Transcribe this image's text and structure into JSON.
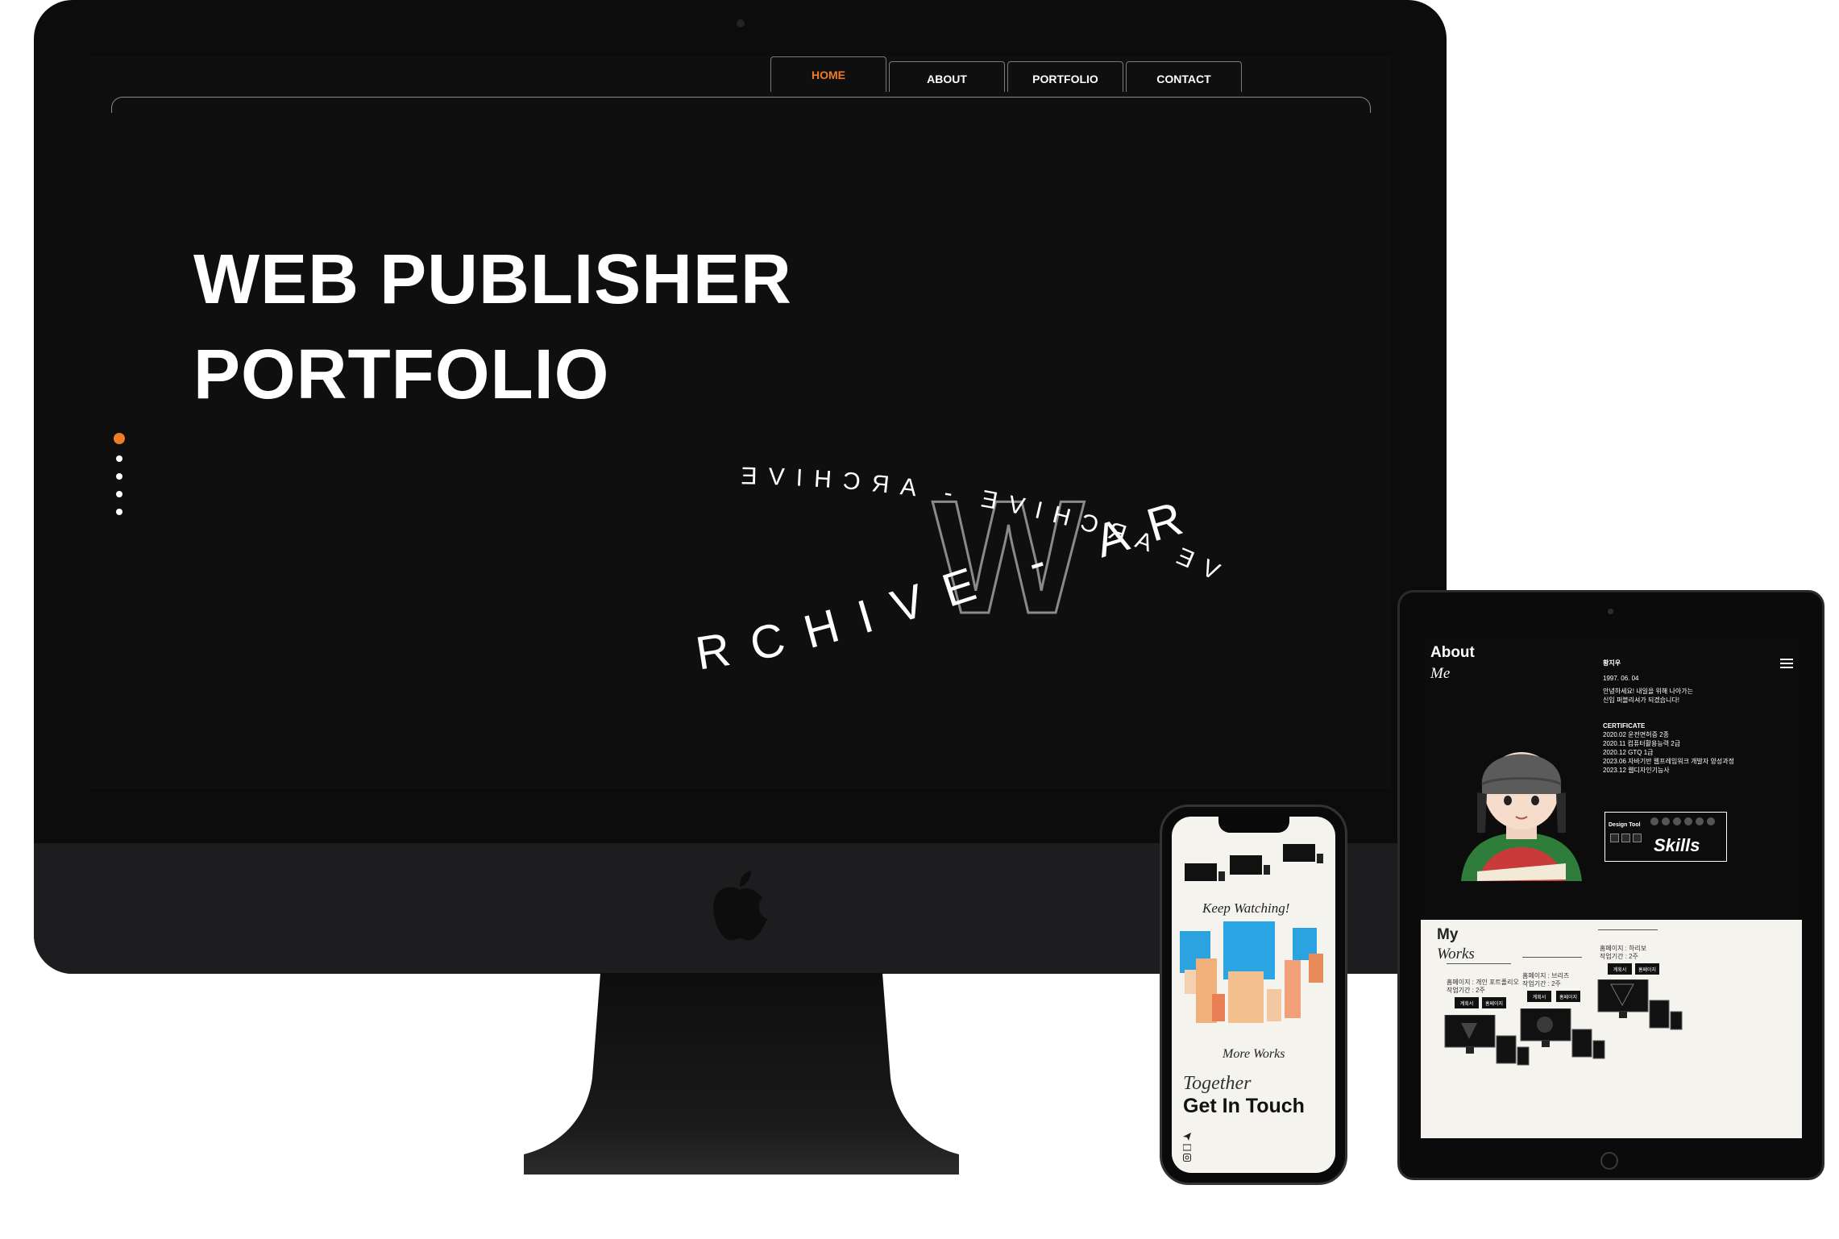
{
  "desktop": {
    "nav": {
      "home": "HOME",
      "about": "ABOUT",
      "portfolio": "PORTFOLIO",
      "contact": "CONTACT"
    },
    "hero": {
      "line1": "WEB PUBLISHER",
      "line2": "PORTFOLIO"
    },
    "graphic": {
      "letter": "W",
      "ring_back": "VE ARCHIVE - ARCHIVE",
      "ring_front": "RCHIVE - ARC"
    },
    "accent_color": "#f07b26"
  },
  "tablet": {
    "about": {
      "title": "About",
      "subtitle": "Me",
      "name": "황지우",
      "birth": "1997. 06. 04",
      "intro1": "안녕하세요! 내일을 위해 나아가는",
      "intro2": "신입 퍼블리셔가 되겠습니다!",
      "certificate_title": "CERTIFICATE",
      "certificates": [
        "2020.02  운전면허증 2종",
        "2020.11  컴퓨터활용능력 2급",
        "2020.12  GTQ 1급",
        "2023.06  자바기반 웹프레임워크 개발자 양성과정",
        "2023.12  웹디자인기능사"
      ],
      "design_tool": "Design Tool",
      "skills": "Skills"
    },
    "works": {
      "title": "My",
      "subtitle": "Works",
      "items": [
        {
          "label": "홈페이지 : 개인 포트폴리오",
          "period": "작업기간 : 2주",
          "btn1": "계획서",
          "btn2": "홈페이지"
        },
        {
          "label": "홈페이지 : 브리즈",
          "period": "작업기간 : 2주",
          "btn1": "계획서",
          "btn2": "홈페이지"
        },
        {
          "label": "홈페이지 : 하리보",
          "period": "작업기간 : 2주",
          "btn1": "계획서",
          "btn2": "홈페이지"
        }
      ]
    }
  },
  "phone": {
    "keep_watching": "Keep Watching!",
    "more_works": "More Works",
    "together": "Together",
    "get_in_touch": "Get In Touch"
  }
}
